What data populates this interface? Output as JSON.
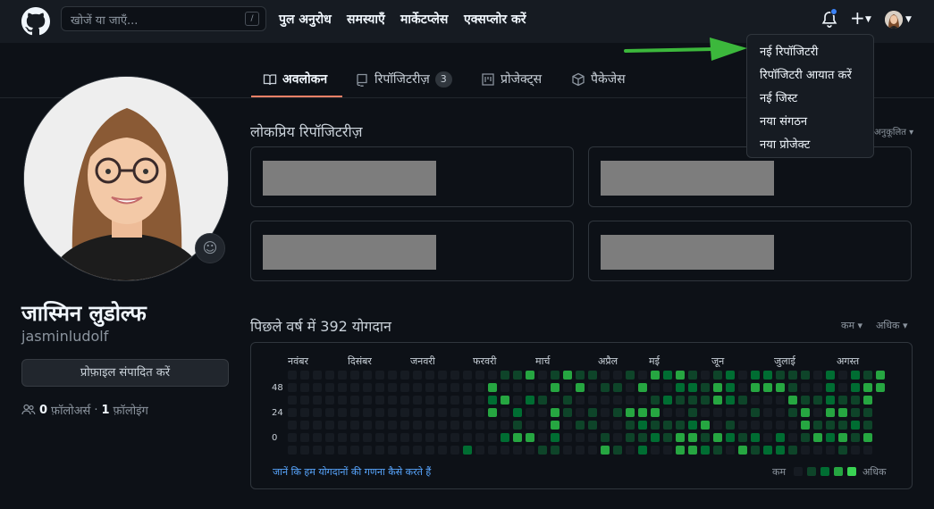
{
  "header": {
    "search_placeholder": "खोजें या जाएँ...",
    "search_shortcut": "/",
    "nav": [
      "पुल अनुरोध",
      "समस्याएँ",
      "मार्केटप्लेस",
      "एक्सप्लोर करें"
    ]
  },
  "dropdown": {
    "items": [
      "नई रिपॉजिटरी",
      "रिपॉजिटरी आयात करें",
      "नई जिस्ट",
      "नया संगठन",
      "नया प्रोजेक्ट"
    ]
  },
  "tabs": [
    {
      "label": "अवलोकन",
      "icon": "book-icon"
    },
    {
      "label": "रिपॉजिटरीज़",
      "count": "3",
      "icon": "repo-icon"
    },
    {
      "label": "प्रोजेक्ट्स",
      "icon": "project-icon"
    },
    {
      "label": "पैकेजेस",
      "icon": "package-icon"
    }
  ],
  "profile": {
    "name": "जास्मिन लुडोल्फ",
    "username": "jasminludolf",
    "edit_button": "प्रोफ़ाइल संपादित करें",
    "followers_count": "0",
    "followers_label": "फ़ॉलोअर्स",
    "separator": "·",
    "following_count": "1",
    "following_label": "फ़ॉलोइंग"
  },
  "popular": {
    "title": "लोकप्रिय रिपॉजिटरीज़",
    "customize": "अनुकूलित"
  },
  "contributions": {
    "title": "पिछले वर्ष में 392 योगदान",
    "sort_less": "कम",
    "sort_more": "अधिक",
    "months": [
      "नवंबर",
      "दिसंबर",
      "जनवरी",
      "फरवरी",
      "मार्च",
      "अप्रैल",
      "मई",
      "जून",
      "जुलाई",
      "अगस्त"
    ],
    "day_labels": [
      "48",
      "24",
      "0"
    ],
    "learn_link": "जानें कि हम योगदानों की गणना कैसे करते हैं",
    "legend_less": "कम",
    "legend_more": "अधिक"
  },
  "colors": {
    "level0": "#161b22",
    "level1": "#0e4429",
    "level2": "#006d32",
    "level3": "#26a641",
    "level4": "#39d353",
    "accent": "#f78166",
    "arrow": "#3cb83c"
  }
}
